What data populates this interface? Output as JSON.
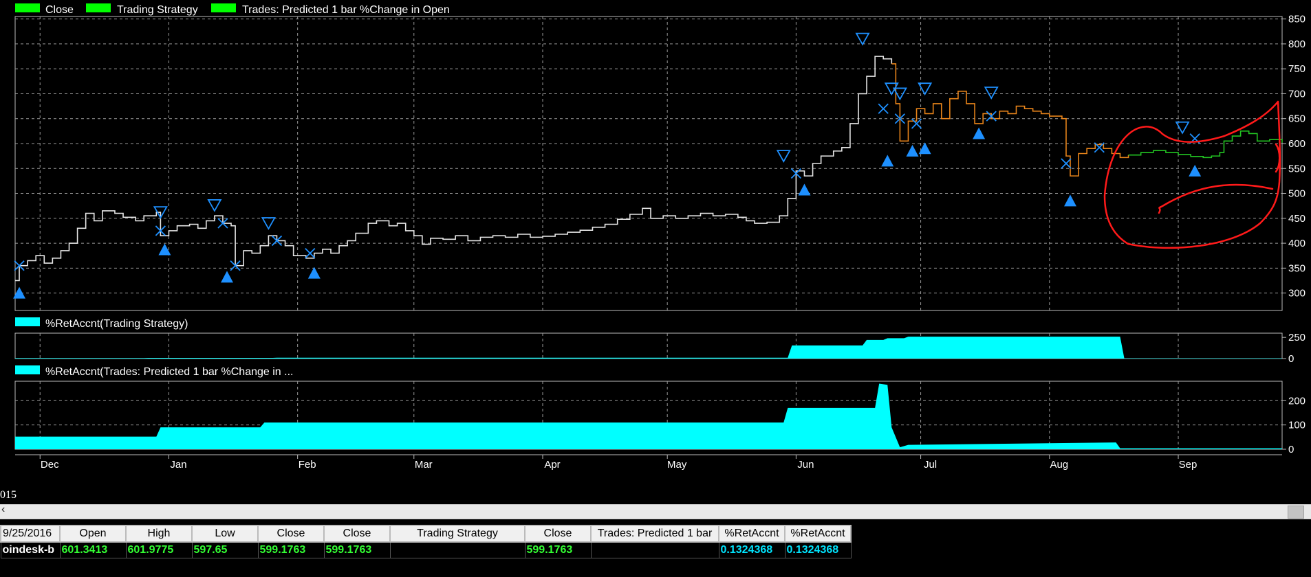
{
  "colors": {
    "background": "#000000",
    "price_line": "#e6e6e6",
    "orange_segment": "#e8841a",
    "green_segment": "#22c422",
    "legend_green": "#00ff00",
    "fill_cyan": "#00ffff",
    "marker_blue": "#1e90ff",
    "annotation_red": "#ff1a1a"
  },
  "chart_data": [
    {
      "type": "line",
      "panel": "price",
      "legend": [
        {
          "label": "Close",
          "color": "#00ff00"
        },
        {
          "label": "Trading Strategy",
          "color": "#00ff00"
        },
        {
          "label": "Trades: Predicted 1 bar %Change in Open",
          "color": "#00ff00"
        }
      ],
      "y_ticks": [
        300,
        350,
        400,
        450,
        500,
        550,
        600,
        650,
        700,
        750,
        800,
        850
      ],
      "ylim": [
        265,
        855
      ],
      "x_ticks": [
        "Dec",
        "Jan",
        "Feb",
        "Mar",
        "Apr",
        "May",
        "Jun",
        "Jul",
        "Aug",
        "Sep"
      ],
      "x_tick_days": [
        6,
        37,
        68,
        96,
        127,
        157,
        188,
        218,
        249,
        280
      ],
      "xlim": [
        0,
        305
      ],
      "grid": true,
      "series": [
        {
          "color": "#e6e6e6",
          "points": [
            [
              0,
              325
            ],
            [
              1,
              355
            ],
            [
              3,
              365
            ],
            [
              5,
              375
            ],
            [
              7,
              360
            ],
            [
              9,
              370
            ],
            [
              11,
              385
            ],
            [
              13,
              400
            ],
            [
              15,
              430
            ],
            [
              17,
              460
            ],
            [
              19,
              445
            ],
            [
              21,
              465
            ],
            [
              24,
              460
            ],
            [
              26,
              452
            ],
            [
              29,
              445
            ],
            [
              31,
              455
            ],
            [
              34,
              462
            ],
            [
              35,
              415
            ],
            [
              37,
              425
            ],
            [
              39,
              435
            ],
            [
              42,
              438
            ],
            [
              44,
              430
            ],
            [
              46,
              445
            ],
            [
              48,
              455
            ],
            [
              50,
              440
            ],
            [
              52,
              435
            ],
            [
              53,
              355
            ],
            [
              55,
              385
            ],
            [
              57,
              380
            ],
            [
              59,
              395
            ],
            [
              61,
              415
            ],
            [
              63,
              405
            ],
            [
              65,
              395
            ],
            [
              67,
              375
            ],
            [
              70,
              370
            ],
            [
              72,
              380
            ],
            [
              74,
              388
            ],
            [
              76,
              380
            ],
            [
              78,
              395
            ],
            [
              80,
              405
            ],
            [
              82,
              420
            ],
            [
              85,
              440
            ],
            [
              87,
              445
            ],
            [
              90,
              435
            ],
            [
              92,
              440
            ],
            [
              94,
              425
            ],
            [
              96,
              415
            ],
            [
              98,
              398
            ],
            [
              100,
              410
            ],
            [
              103,
              408
            ],
            [
              106,
              415
            ],
            [
              109,
              405
            ],
            [
              112,
              412
            ],
            [
              115,
              415
            ],
            [
              118,
              412
            ],
            [
              121,
              418
            ],
            [
              124,
              412
            ],
            [
              127,
              414
            ],
            [
              130,
              418
            ],
            [
              133,
              422
            ],
            [
              136,
              426
            ],
            [
              139,
              432
            ],
            [
              142,
              438
            ],
            [
              145,
              448
            ],
            [
              148,
              458
            ],
            [
              151,
              470
            ],
            [
              153,
              450
            ],
            [
              156,
              455
            ],
            [
              159,
              450
            ],
            [
              162,
              455
            ],
            [
              165,
              460
            ],
            [
              168,
              455
            ],
            [
              171,
              458
            ],
            [
              174,
              452
            ],
            [
              176,
              445
            ],
            [
              178,
              440
            ],
            [
              181,
              442
            ],
            [
              184,
              455
            ],
            [
              186,
              490
            ],
            [
              188,
              545
            ],
            [
              190,
              535
            ],
            [
              192,
              560
            ],
            [
              194,
              575
            ],
            [
              197,
              585
            ],
            [
              199,
              592
            ],
            [
              201,
              640
            ],
            [
              203,
              700
            ],
            [
              205,
              735
            ],
            [
              207,
              775
            ],
            [
              209,
              770
            ],
            [
              211,
              760
            ]
          ]
        },
        {
          "color": "#e8841a",
          "points": [
            [
              211,
              760
            ],
            [
              212,
              680
            ],
            [
              213,
              605
            ],
            [
              215,
              645
            ],
            [
              217,
              670
            ],
            [
              219,
              660
            ],
            [
              221,
              680
            ],
            [
              223,
              650
            ],
            [
              225,
              690
            ],
            [
              227,
              705
            ],
            [
              229,
              680
            ],
            [
              231,
              640
            ],
            [
              233,
              660
            ],
            [
              235,
              650
            ],
            [
              237,
              665
            ],
            [
              239,
              660
            ],
            [
              241,
              675
            ],
            [
              243,
              670
            ],
            [
              245,
              665
            ],
            [
              247,
              660
            ],
            [
              249,
              655
            ],
            [
              252,
              650
            ],
            [
              253,
              575
            ],
            [
              254,
              535
            ],
            [
              256,
              580
            ],
            [
              258,
              590
            ],
            [
              260,
              598
            ],
            [
              262,
              590
            ],
            [
              264,
              580
            ],
            [
              266,
              572
            ],
            [
              268,
              577
            ]
          ]
        },
        {
          "color": "#22c422",
          "points": [
            [
              268,
              577
            ],
            [
              271,
              582
            ],
            [
              274,
              586
            ],
            [
              277,
              582
            ],
            [
              280,
              578
            ],
            [
              283,
              574
            ],
            [
              286,
              572
            ],
            [
              288,
              575
            ],
            [
              290,
              582
            ],
            [
              291,
              605
            ],
            [
              293,
              615
            ],
            [
              295,
              625
            ],
            [
              297,
              620
            ],
            [
              299,
              605
            ],
            [
              302,
              608
            ],
            [
              305,
              602
            ]
          ]
        }
      ],
      "buy_markers": [
        [
          1,
          300
        ],
        [
          36,
          387
        ],
        [
          51,
          332
        ],
        [
          72,
          340
        ],
        [
          190,
          507
        ],
        [
          210,
          565
        ],
        [
          216,
          585
        ],
        [
          219,
          590
        ],
        [
          232,
          620
        ],
        [
          254,
          485
        ],
        [
          284,
          545
        ]
      ],
      "sell_markers": [
        [
          35,
          462
        ],
        [
          48,
          476
        ],
        [
          61,
          440
        ],
        [
          185,
          575
        ],
        [
          204,
          810
        ],
        [
          211,
          710
        ],
        [
          213,
          700
        ],
        [
          219,
          710
        ],
        [
          235,
          702
        ],
        [
          281,
          632
        ]
      ],
      "exit_markers": [
        [
          1,
          355
        ],
        [
          35,
          425
        ],
        [
          50,
          440
        ],
        [
          53,
          355
        ],
        [
          63,
          405
        ],
        [
          71,
          380
        ],
        [
          188,
          540
        ],
        [
          209,
          670
        ],
        [
          213,
          650
        ],
        [
          217,
          640
        ],
        [
          235,
          655
        ],
        [
          253,
          560
        ],
        [
          261,
          592
        ],
        [
          284,
          610
        ]
      ]
    },
    {
      "type": "area",
      "panel": "retaccnt_strategy",
      "legend": [
        {
          "label": "%RetAccnt(Trading Strategy)",
          "color": "#00ffff"
        }
      ],
      "y_ticks": [
        0,
        250
      ],
      "ylim": [
        0,
        300
      ],
      "x": [
        0,
        31,
        32,
        62,
        63,
        186,
        187,
        204,
        205,
        209,
        210,
        214,
        215,
        266,
        267,
        305
      ],
      "values": [
        6,
        6,
        8,
        8,
        10,
        10,
        155,
        155,
        220,
        220,
        240,
        240,
        258,
        258,
        4,
        4
      ]
    },
    {
      "type": "area",
      "panel": "retaccnt_trades",
      "legend": [
        {
          "label": "%RetAccnt(Trades: Predicted 1 bar %Change in ...",
          "color": "#00ffff"
        }
      ],
      "y_ticks": [
        0,
        100,
        200
      ],
      "ylim": [
        0,
        280
      ],
      "x": [
        0,
        34,
        35,
        59,
        60,
        185,
        186,
        207,
        208,
        210,
        211,
        213,
        215,
        265,
        266,
        305
      ],
      "values": [
        52,
        52,
        90,
        90,
        110,
        110,
        170,
        170,
        270,
        265,
        90,
        8,
        18,
        28,
        4,
        4
      ]
    }
  ],
  "footer": {
    "date_stub": "015",
    "headers": [
      "9/25/2016",
      "Open",
      "High",
      "Low",
      "Close",
      "Close",
      "Trading Strategy",
      "Close",
      "Trades: Predicted 1 bar",
      "%RetAccnt",
      "%RetAccnt"
    ],
    "values": [
      "oindesk-b",
      "601.3413",
      "601.9775",
      "597.65",
      "599.1763",
      "599.1763",
      "",
      "599.1763",
      "",
      "0.1324368",
      "0.1324368"
    ]
  }
}
